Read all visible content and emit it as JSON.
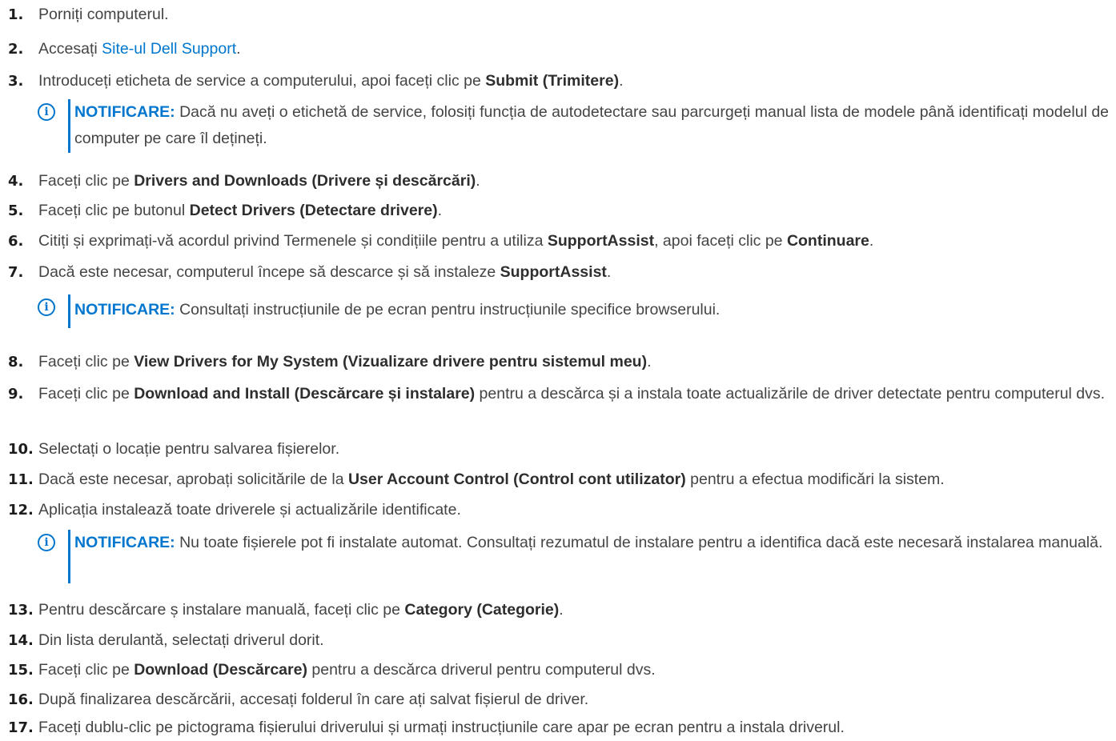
{
  "steps": [
    {
      "n": "1.",
      "a": "Porniți computerul."
    },
    {
      "n": "2.",
      "a": "Accesați ",
      "link": "Site-ul Dell Support",
      "c": "."
    },
    {
      "n": "3.",
      "a": "Introduceți eticheta de service a computerului, apoi faceți clic pe ",
      "b": "Submit (Trimitere)",
      "c": "."
    },
    {
      "n": "4.",
      "a": "Faceți clic pe ",
      "b": "Drivers and Downloads (Drivere și descărcări)",
      "c": "."
    },
    {
      "n": "5.",
      "a": "Faceți clic pe butonul ",
      "b": "Detect Drivers (Detectare drivere)",
      "c": "."
    },
    {
      "n": "6.",
      "a": "Citiți și exprimați-vă acordul privind Termenele și condițiile pentru a utiliza ",
      "b": "SupportAssist",
      "c": ", apoi faceți clic pe ",
      "d": "Continuare",
      "e": "."
    },
    {
      "n": "7.",
      "a": "Dacă este necesar, computerul începe să descarce și să instaleze ",
      "b": "SupportAssist",
      "c": "."
    },
    {
      "n": "8.",
      "a": "Faceți clic pe ",
      "b": "View Drivers for My System (Vizualizare drivere pentru sistemul meu)",
      "c": "."
    },
    {
      "n": "9.",
      "a": "Faceți clic pe ",
      "b": "Download and Install (Descărcare și instalare)",
      "c": " pentru a descărca și a instala toate actualizările de driver detectate pentru computerul dvs."
    },
    {
      "n": "10.",
      "a": "Selectați o locație pentru salvarea fișierelor."
    },
    {
      "n": "11.",
      "a": "Dacă este necesar, aprobați solicitările de la ",
      "b": "User Account Control (Control cont utilizator)",
      "c": " pentru a efectua modificări la sistem."
    },
    {
      "n": "12.",
      "a": "Aplicația instalează toate driverele și actualizările identificate."
    },
    {
      "n": "13.",
      "a": "Pentru descărcare ș instalare manuală, faceți clic pe ",
      "b": "Category (Categorie)",
      "c": "."
    },
    {
      "n": "14.",
      "a": "Din lista derulantă, selectați driverul dorit."
    },
    {
      "n": "15.",
      "a": "Faceți clic pe ",
      "b": "Download (Descărcare)",
      "c": " pentru a descărca driverul pentru computerul dvs."
    },
    {
      "n": "16.",
      "a": "După finalizarea descărcării, accesați folderul în care ați salvat fișierul de driver."
    },
    {
      "n": "17.",
      "a": "Faceți dublu-clic pe pictograma fișierului driverului și urmați instrucțiunile care apar pe ecran pentru a instala driverul."
    }
  ],
  "notes": [
    {
      "label": "NOTIFICARE:",
      "text": " Dacă nu aveți o etichetă de service, folosiți funcția de autodetectare sau parcurgeți manual lista de modele până identificați modelul de computer pe care îl dețineți."
    },
    {
      "label": "NOTIFICARE:",
      "text": " Consultați instrucțiunile de pe ecran pentru instrucțiunile specifice browserului."
    },
    {
      "label": "NOTIFICARE:",
      "text": " Nu toate fișierele pot fi instalate automat. Consultați rezumatul de instalare pentru a identifica dacă este necesară instalarea manuală."
    }
  ],
  "icons": {
    "note": "info-icon",
    "note_glyph": "i"
  },
  "colors": {
    "accent": "#0076ce",
    "text": "#444444"
  }
}
